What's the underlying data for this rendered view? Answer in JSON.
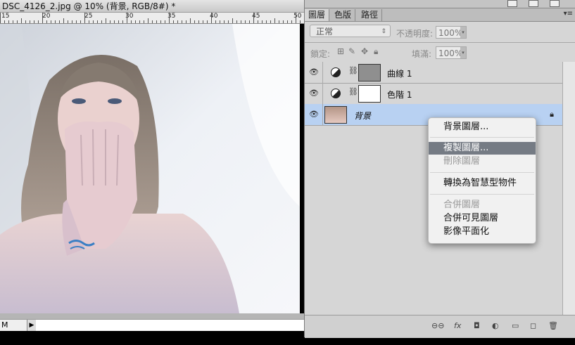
{
  "document": {
    "title": "DSC_4126_2.jpg @ 10% (背景, RGB/8#) *",
    "ruler_numbers": [
      "15",
      "20",
      "25",
      "30",
      "35",
      "40",
      "45",
      "50"
    ],
    "zoom": "M",
    "status_arrow": "▶"
  },
  "panel": {
    "tabs": [
      "圖層",
      "色版",
      "路徑"
    ],
    "active_tab": "圖層",
    "tab_menu_icon": "▾≡",
    "blend_mode": "正常",
    "opacity_label": "不透明度:",
    "opacity_value": "100%",
    "lock_label": "鎖定:",
    "fill_label": "填滿:",
    "fill_value": "100%",
    "layers": [
      {
        "name": "曲線 1",
        "selected": false
      },
      {
        "name": "色階 1",
        "selected": false
      },
      {
        "name": "背景",
        "selected": true
      }
    ],
    "bottom_icons": [
      "link-icon",
      "fx-icon",
      "mask-icon",
      "adjustment-icon",
      "group-icon",
      "new-layer-icon",
      "trash-icon"
    ],
    "bottom_labels": [
      "⊖⊖",
      "fx",
      "◘",
      "◐",
      "▭",
      "◻",
      "🗑"
    ]
  },
  "context_menu": {
    "items": [
      {
        "label": "背景圖層...",
        "state": "normal"
      },
      {
        "label": "複製圖層...",
        "state": "highlighted"
      },
      {
        "label": "刪除圖層",
        "state": "disabled"
      },
      {
        "label": "轉換為智慧型物件",
        "state": "normal"
      },
      {
        "label": "合併圖層",
        "state": "disabled"
      },
      {
        "label": "合併可見圖層",
        "state": "normal"
      },
      {
        "label": "影像平面化",
        "state": "normal"
      }
    ]
  },
  "colors": {
    "selection": "#b8d1f2",
    "menu_highlight": "#757b84",
    "panel_bg": "#d6d6d6"
  }
}
